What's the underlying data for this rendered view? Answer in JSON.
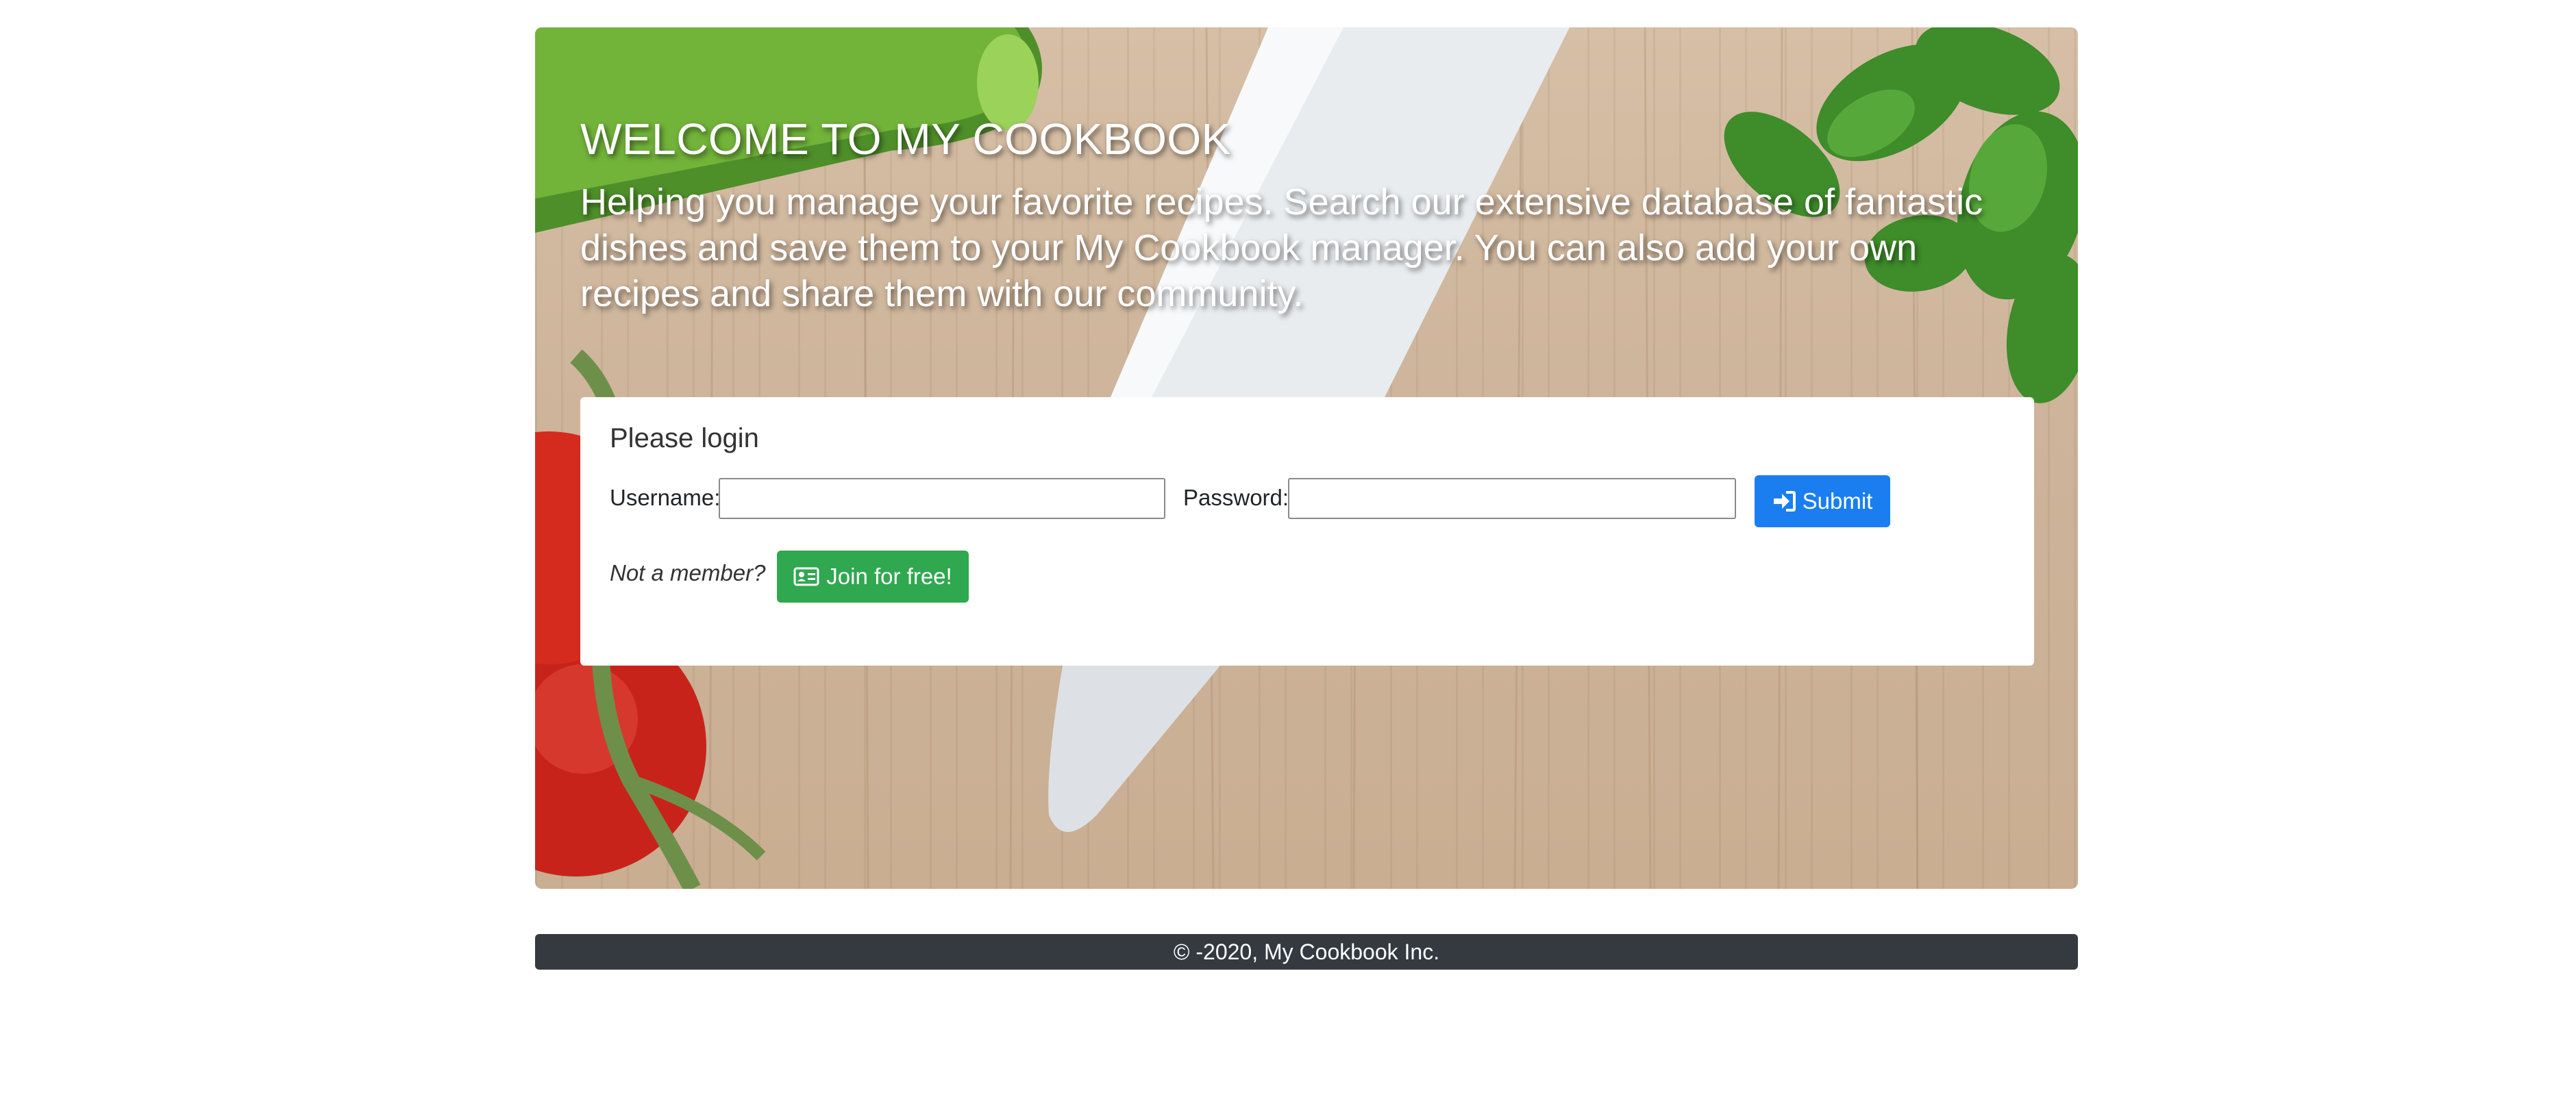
{
  "hero": {
    "title": "WELCOME TO MY COOKBOOK",
    "subtitle": "Helping you manage your favorite recipes. Search our extensive database of fantastic dishes and save them to your My Cookbook manager. You can also add your own recipes and share them with our community."
  },
  "login": {
    "heading": "Please login",
    "username_label": "Username:",
    "username_value": "",
    "password_label": "Password:",
    "password_value": "",
    "submit_label": "Submit",
    "submit_icon": "sign-in-icon",
    "not_member_text": "Not a member?",
    "join_label": "Join for free!",
    "join_icon": "id-card-icon"
  },
  "footer": {
    "copyright": "© -2020, My Cookbook Inc."
  },
  "colors": {
    "submit_button": "#1a7ef0",
    "join_button": "#2fa84f",
    "footer_background": "#343a40",
    "hero_wood": "#cdb49a"
  }
}
